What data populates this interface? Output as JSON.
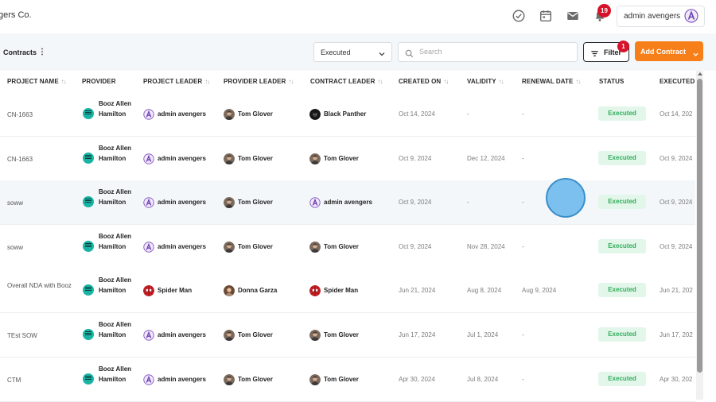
{
  "app": {
    "company_name": "gers Co."
  },
  "topbar": {
    "icons": [
      "check-circle-icon",
      "calendar-icon",
      "mail-icon",
      "bell-icon"
    ],
    "notification_count": "19",
    "user_name": "admin avengers"
  },
  "toolbar": {
    "breadcrumb": "Contracts",
    "status_filter": "Executed",
    "search_placeholder": "Search",
    "filter_label": "Filter",
    "filter_count": "1",
    "add_label": "Add Contract"
  },
  "table": {
    "headers": {
      "project_name": "PROJECT NAME",
      "provider": "PROVIDER",
      "project_leader": "PROJECT LEADER",
      "provider_leader": "PROVIDER LEADER",
      "contract_leader": "CONTRACT LEADER",
      "created_on": "CREATED ON",
      "validity": "VALIDITY",
      "renewal_date": "RENEWAL DATE",
      "status": "STATUS",
      "executed": "EXECUTED"
    },
    "rows": [
      {
        "project_name": "CN-1663",
        "provider": "Booz Allen Hamilton",
        "project_leader": "admin avengers",
        "provider_leader": "Tom Glover",
        "contract_leader": "Black Panther",
        "created_on": "Oct 14, 2024",
        "validity": "-",
        "renewal_date": "-",
        "status": "Executed",
        "executed": "Oct 14, 202"
      },
      {
        "project_name": "CN-1663",
        "provider": "Booz Allen Hamilton",
        "project_leader": "admin avengers",
        "provider_leader": "Tom Glover",
        "contract_leader": "Tom Glover",
        "created_on": "Oct 9, 2024",
        "validity": "Dec 12, 2024",
        "renewal_date": "-",
        "status": "Executed",
        "executed": "Oct 9, 2024"
      },
      {
        "project_name": "soww",
        "provider": "Booz Allen Hamilton",
        "project_leader": "admin avengers",
        "provider_leader": "Tom Glover",
        "contract_leader": "admin avengers",
        "created_on": "Oct 9, 2024",
        "validity": "-",
        "renewal_date": "-",
        "status": "Executed",
        "executed": "Oct 9, 2024"
      },
      {
        "project_name": "soww",
        "provider": "Booz Allen Hamilton",
        "project_leader": "admin avengers",
        "provider_leader": "Tom Glover",
        "contract_leader": "Tom Glover",
        "created_on": "Oct 9, 2024",
        "validity": "Nov 28, 2024",
        "renewal_date": "-",
        "status": "Executed",
        "executed": "Oct 9, 2024"
      },
      {
        "project_name": "Overall NDA with Booz",
        "provider": "Booz Allen Hamilton",
        "project_leader": "Spider Man",
        "provider_leader": "Donna Garza",
        "contract_leader": "Spider Man",
        "created_on": "Jun 21, 2024",
        "validity": "Aug 8, 2024",
        "renewal_date": "Aug 9, 2024",
        "status": "Executed",
        "executed": "Jun 21, 202"
      },
      {
        "project_name": "TEst SOW",
        "provider": "Booz Allen Hamilton",
        "project_leader": "admin avengers",
        "provider_leader": "Tom Glover",
        "contract_leader": "Tom Glover",
        "created_on": "Jun 17, 2024",
        "validity": "Jul 1, 2024",
        "renewal_date": "-",
        "status": "Executed",
        "executed": "Jun 17, 202"
      },
      {
        "project_name": "CTM",
        "provider": "Booz Allen Hamilton",
        "project_leader": "admin avengers",
        "provider_leader": "Tom Glover",
        "contract_leader": "Tom Glover",
        "created_on": "Apr 30, 2024",
        "validity": "Jul 8, 2024",
        "renewal_date": "-",
        "status": "Executed",
        "executed": "Apr 30, 202"
      }
    ]
  },
  "colors": {
    "accent": "#f77f1a",
    "badge": "#d6132b",
    "status_bg": "#e3f6ea",
    "status_text": "#2fae5b"
  }
}
